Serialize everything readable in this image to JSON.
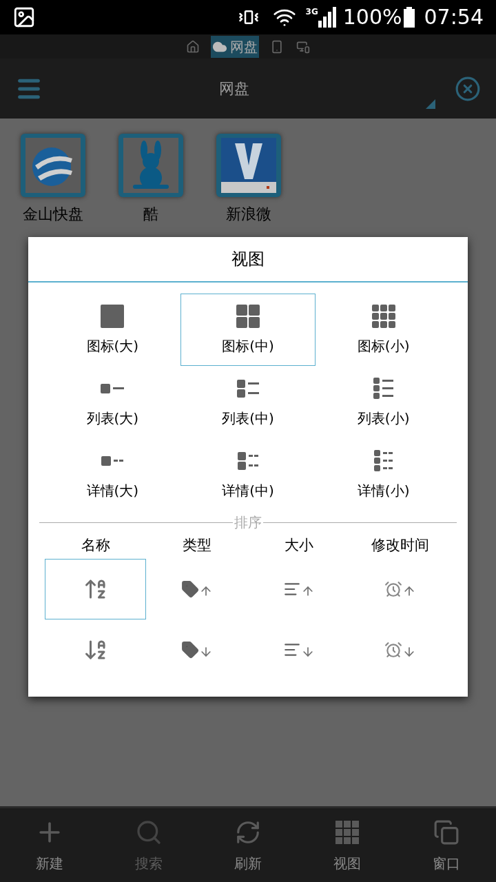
{
  "status_bar": {
    "network": "3G",
    "battery": "100%",
    "time": "07:54"
  },
  "location_tabs": [
    {
      "kind": "home",
      "selected": false
    },
    {
      "kind": "cloud",
      "label": "网盘",
      "selected": true
    },
    {
      "kind": "phone",
      "selected": false
    },
    {
      "kind": "devices",
      "selected": false
    }
  ],
  "title_bar": {
    "title": "网盘"
  },
  "files": [
    {
      "kind": "globe",
      "label": "金山快盘"
    },
    {
      "kind": "rabbit",
      "label": "酷"
    },
    {
      "kind": "v",
      "label": "新浪微"
    }
  ],
  "dialog": {
    "title": "视图",
    "views": [
      {
        "kind": "icon-large",
        "label": "图标(大)",
        "selected": false
      },
      {
        "kind": "icon-medium",
        "label": "图标(中)",
        "selected": true
      },
      {
        "kind": "icon-small",
        "label": "图标(小)",
        "selected": false
      },
      {
        "kind": "list-large",
        "label": "列表(大)",
        "selected": false
      },
      {
        "kind": "list-medium",
        "label": "列表(中)",
        "selected": false
      },
      {
        "kind": "list-small",
        "label": "列表(小)",
        "selected": false
      },
      {
        "kind": "details-large",
        "label": "详情(大)",
        "selected": false
      },
      {
        "kind": "details-medium",
        "label": "详情(中)",
        "selected": false
      },
      {
        "kind": "details-small",
        "label": "详情(小)",
        "selected": false
      }
    ],
    "sort": {
      "label": "排序",
      "columns": [
        {
          "kind": "name",
          "label": "名称",
          "options": [
            {
              "kind": "asc",
              "selected": true
            },
            {
              "kind": "desc",
              "selected": false
            }
          ]
        },
        {
          "kind": "type",
          "label": "类型",
          "options": [
            {
              "kind": "asc",
              "selected": false
            },
            {
              "kind": "desc",
              "selected": false
            }
          ]
        },
        {
          "kind": "size",
          "label": "大小",
          "options": [
            {
              "kind": "asc",
              "selected": false
            },
            {
              "kind": "desc",
              "selected": false
            }
          ]
        },
        {
          "kind": "time",
          "label": "修改时间",
          "options": [
            {
              "kind": "asc",
              "selected": false
            },
            {
              "kind": "desc",
              "selected": false
            }
          ]
        }
      ]
    }
  },
  "toolbar": [
    {
      "kind": "add",
      "label": "新建",
      "disabled": false
    },
    {
      "kind": "search",
      "label": "搜索",
      "disabled": true
    },
    {
      "kind": "refresh",
      "label": "刷新",
      "disabled": false
    },
    {
      "kind": "view",
      "label": "视图",
      "disabled": false
    },
    {
      "kind": "window",
      "label": "窗口",
      "disabled": false
    }
  ]
}
